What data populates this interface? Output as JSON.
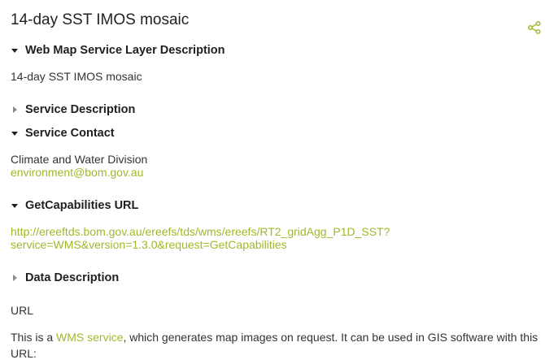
{
  "title": "14-day SST IMOS mosaic",
  "share_icon": "share-icon",
  "accent_color": "#9fb92a",
  "sections": {
    "wms_layer": {
      "label": "Web Map Service Layer Description",
      "expanded": true,
      "content": "14-day SST IMOS mosaic"
    },
    "service_description": {
      "label": "Service Description",
      "expanded": false
    },
    "service_contact": {
      "label": "Service Contact",
      "expanded": true,
      "organisation": "Climate and Water Division",
      "email": "environment@bom.gov.au"
    },
    "getcapabilities": {
      "label": "GetCapabilities URL",
      "expanded": true,
      "url_line1": "http://ereeftds.bom.gov.au/ereefs/tds/wms/ereefs/RT2_gridAgg_P1D_SST?",
      "url_line2": "service=WMS&version=1.3.0&request=GetCapabilities"
    },
    "data_description": {
      "label": "Data Description",
      "expanded": false
    }
  },
  "url_heading": "URL",
  "wms_paragraph": {
    "prefix": "This is a ",
    "link_text": "WMS service",
    "suffix": ", which generates map images on request. It can be used in GIS software with this URL:"
  }
}
